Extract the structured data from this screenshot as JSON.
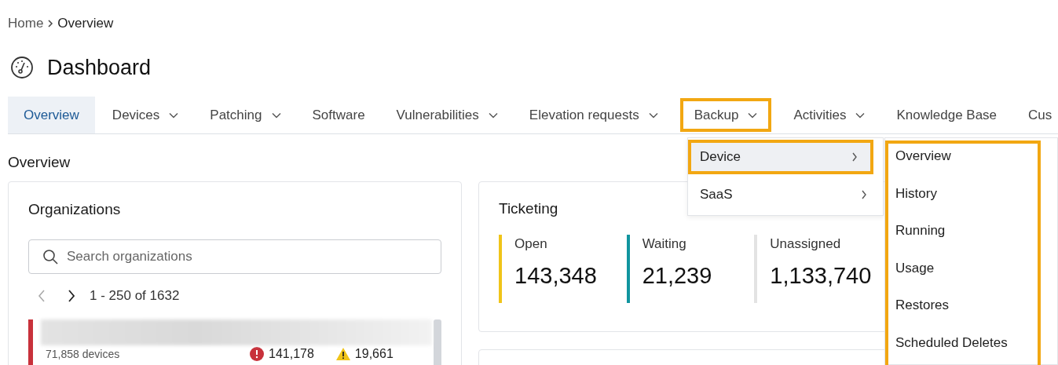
{
  "breadcrumb": {
    "items": [
      "Home",
      "Overview"
    ]
  },
  "page_title": "Dashboard",
  "tabs": [
    {
      "label": "Overview",
      "selected": true,
      "dropdown": false,
      "highlighted": false
    },
    {
      "label": "Devices",
      "selected": false,
      "dropdown": true,
      "highlighted": false
    },
    {
      "label": "Patching",
      "selected": false,
      "dropdown": true,
      "highlighted": false
    },
    {
      "label": "Software",
      "selected": false,
      "dropdown": false,
      "highlighted": false
    },
    {
      "label": "Vulnerabilities",
      "selected": false,
      "dropdown": true,
      "highlighted": false
    },
    {
      "label": "Elevation requests",
      "selected": false,
      "dropdown": true,
      "highlighted": false
    },
    {
      "label": "Backup",
      "selected": false,
      "dropdown": true,
      "highlighted": true
    },
    {
      "label": "Activities",
      "selected": false,
      "dropdown": true,
      "highlighted": false
    },
    {
      "label": "Knowledge Base",
      "selected": false,
      "dropdown": false,
      "highlighted": false
    },
    {
      "label": "Cus",
      "selected": false,
      "dropdown": false,
      "highlighted": false
    }
  ],
  "section_title": "Overview",
  "organizations": {
    "title": "Organizations",
    "search": {
      "placeholder": "Search organizations"
    },
    "range": "1 - 250 of 1632",
    "rows": [
      {
        "devices": "71,858 devices",
        "errors": "141,178",
        "warnings": "19,661",
        "color": "#c8313b"
      }
    ]
  },
  "ticketing": {
    "title": "Ticketing",
    "stats": [
      {
        "label": "Open",
        "value": "143,348",
        "color": "#f0c419"
      },
      {
        "label": "Waiting",
        "value": "21,239",
        "color": "#11959f"
      },
      {
        "label": "Unassigned",
        "value": "1,133,740",
        "color": "#e3e3e3"
      }
    ]
  },
  "menu": {
    "items": [
      {
        "label": "Device",
        "selected": true,
        "highlighted": true
      },
      {
        "label": "SaaS",
        "selected": false,
        "highlighted": false
      }
    ]
  },
  "submenu": {
    "highlighted": true,
    "items": [
      "Overview",
      "History",
      "Running",
      "Usage",
      "Restores",
      "Scheduled Deletes"
    ]
  }
}
